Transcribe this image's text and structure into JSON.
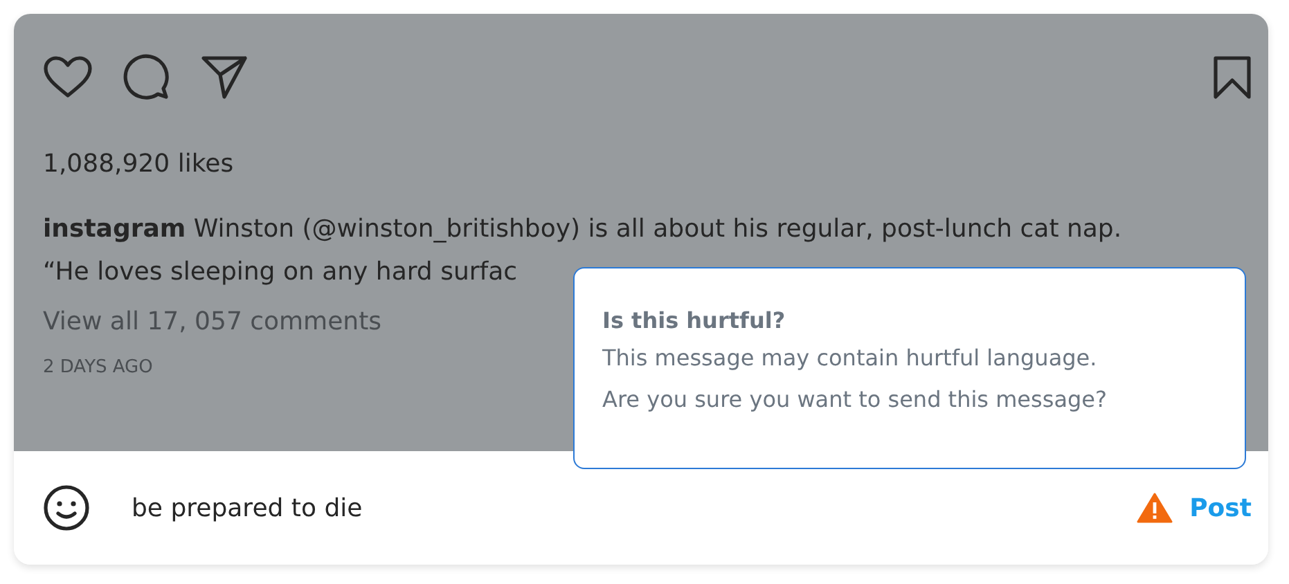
{
  "post": {
    "likes": "1,088,920 likes",
    "caption": [
      "**instagram** Winston (@winston_britishboy) is all about his regular, post-lunch cat nap.",
      "“He loves sleeping on any hard surfac"
    ],
    "comments_link": "View all 17, 057 comments",
    "time": "2 DAYS AGO"
  },
  "comment_box": {
    "value": "be prepared to die",
    "warning": true,
    "post_label": "Post"
  },
  "popup": {
    "title": "Is this hurtful?",
    "lines": [
      "This message may contain hurtful language.",
      "Are you sure you want to send this message?"
    ]
  }
}
